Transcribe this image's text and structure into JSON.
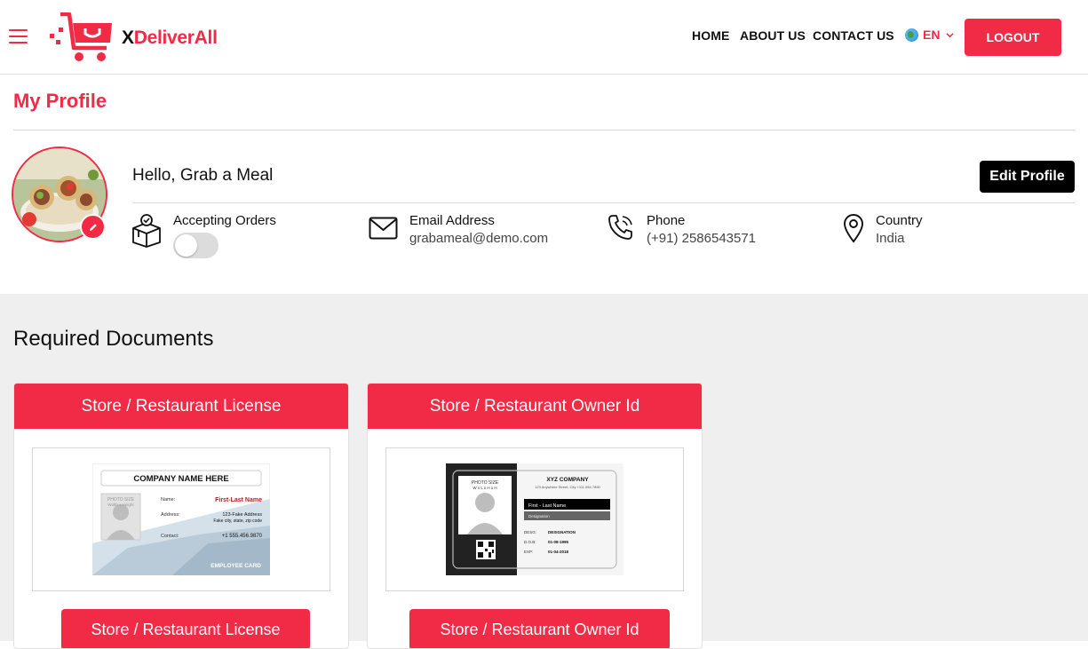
{
  "header": {
    "brand_x": "X",
    "brand_rest": "DeliverAll",
    "nav": [
      "HOME",
      "ABOUT US",
      "CONTACT US"
    ],
    "language": "EN",
    "logout_label": "LOGOUT",
    "accent_color": "#f12b45"
  },
  "profile": {
    "page_title": "My Profile",
    "greeting": "Hello, Grab a Meal",
    "edit_label": "Edit Profile",
    "accepting_orders": {
      "label": "Accepting Orders",
      "enabled": false
    },
    "email": {
      "label": "Email Address",
      "value": "grabameal@demo.com"
    },
    "phone": {
      "label": "Phone",
      "value": "(+91) 2586543571"
    },
    "country": {
      "label": "Country",
      "value": "India"
    }
  },
  "documents": {
    "title": "Required Documents",
    "cards": [
      {
        "header": "Store / Restaurant License",
        "button": "Store / Restaurant License",
        "preview": {
          "company": "COMPANY NAME HERE",
          "photo_text": "PHOTO SIZE",
          "photo_sub": "Width x Height",
          "name_label": "Name:",
          "name_value": "First-Last Name",
          "address_label": "Address:",
          "address_line1": "123-Fake Address",
          "address_line2": "Fake city, state, zip code",
          "contact_label": "Contact:",
          "contact_value": "+1 555.456.9870",
          "footer": "EMPLOYEE CARD"
        }
      },
      {
        "header": "Store / Restaurant Owner Id",
        "button": "Store / Restaurant Owner Id",
        "preview": {
          "photo_text": "PHOTO SIZE",
          "photo_sub": "W x L x H x H",
          "company": "XYZ COMPANY",
          "company_address": "123 Anywhere Street, City +111 654 7890",
          "name": "First - Last Name",
          "designation": "Designation",
          "desig_label": "DESG:",
          "desig_value": "DESIGNATION",
          "dob_label": "D.O.B:",
          "dob_value": "01-08-1995",
          "exp_label": "EXP:",
          "exp_value": "01-04-2018"
        }
      }
    ]
  }
}
